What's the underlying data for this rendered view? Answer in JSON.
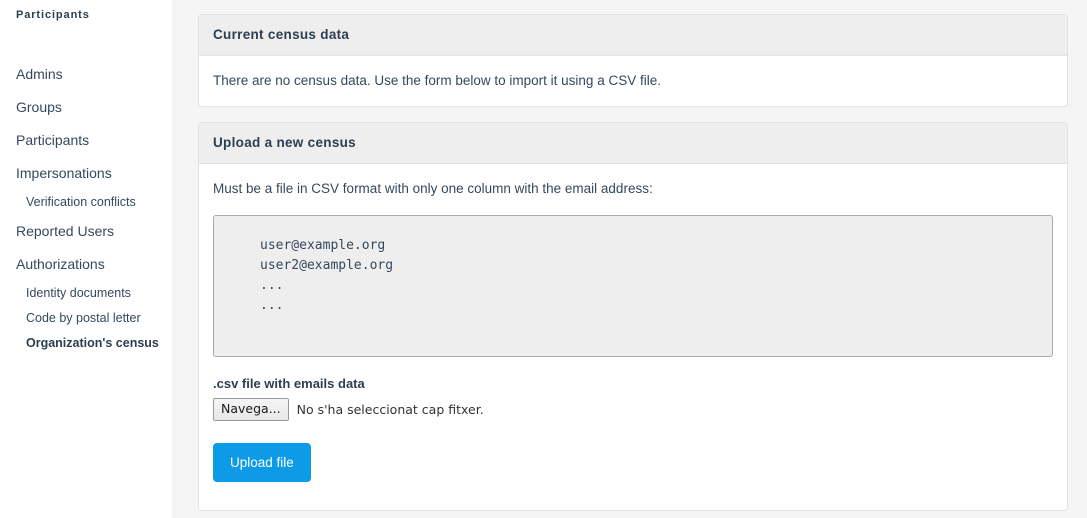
{
  "sidebar": {
    "title": "Participants",
    "items": [
      {
        "label": "Admins",
        "level": "top",
        "active": false,
        "name": "sidebar-item-admins"
      },
      {
        "label": "Groups",
        "level": "top",
        "active": false,
        "name": "sidebar-item-groups"
      },
      {
        "label": "Participants",
        "level": "top",
        "active": false,
        "name": "sidebar-item-participants"
      },
      {
        "label": "Impersonations",
        "level": "top",
        "active": false,
        "name": "sidebar-item-impersonations"
      },
      {
        "label": "Verification conflicts",
        "level": "sub",
        "active": false,
        "name": "sidebar-item-verification-conflicts"
      },
      {
        "label": "Reported Users",
        "level": "top",
        "active": false,
        "name": "sidebar-item-reported-users"
      },
      {
        "label": "Authorizations",
        "level": "top",
        "active": false,
        "name": "sidebar-item-authorizations"
      },
      {
        "label": "Identity documents",
        "level": "sub",
        "active": false,
        "name": "sidebar-item-identity-documents"
      },
      {
        "label": "Code by postal letter",
        "level": "sub",
        "active": false,
        "name": "sidebar-item-code-by-postal-letter"
      },
      {
        "label": "Organization's census",
        "level": "sub",
        "active": true,
        "name": "sidebar-item-organizations-census"
      }
    ]
  },
  "panels": {
    "current": {
      "heading": "Current census data",
      "body": "There are no census data. Use the form below to import it using a CSV file."
    },
    "upload": {
      "heading": "Upload a new census",
      "instructions": "Must be a file in CSV format with only one column with the email address:",
      "code_sample": "user@example.org\nuser2@example.org\n...\n...",
      "file_label": ".csv file with emails data",
      "file_browse_button": "Navega...",
      "file_status": "No s'ha seleccionat cap fitxer.",
      "submit_button": "Upload file"
    }
  },
  "colors": {
    "accent": "#0d9ae6",
    "panel_header_bg": "#eeeeee",
    "content_bg": "#f5f5f5",
    "code_bg": "#eeeeee",
    "code_border": "#aaaaaa",
    "text": "#2c3e50"
  }
}
